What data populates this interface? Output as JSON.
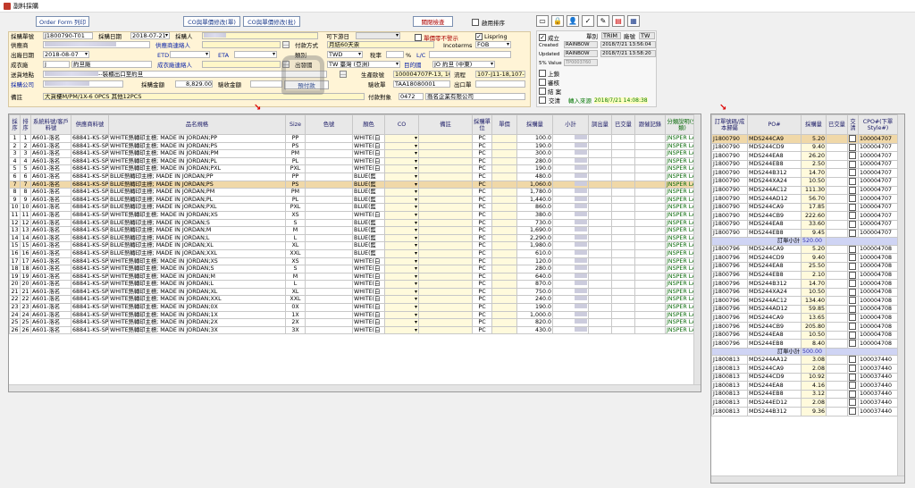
{
  "window": {
    "title": "副料採購"
  },
  "top": {
    "order_form_btn": "Order Form 列印",
    "co_change_btn1": "CO與單價修改(單)",
    "co_change_btn2": "CO與單價修改(批)",
    "close_btn": "關閉檢查",
    "startup_sort_label": "啟用排序"
  },
  "form": {
    "purchase_no_label": "採購單號",
    "purchase_no": "J1800790-T01",
    "purchase_date_label": "採購日期",
    "purchase_date": "2018-07-21",
    "buyer_label": "採購人",
    "deliverable_label": "可下游日",
    "price_no_warn_label": "單價零不警示",
    "lispring_label": "Lispring",
    "supplier_label": "供應商",
    "supplier_contact_label": "供應商連絡人",
    "pay_method_label": "付款方式",
    "pay_method": "月結60天票",
    "incoterms_label": "Incoterms",
    "incoterms": "FOB",
    "ship_date_label": "出廠日期",
    "ship_date": "2018-08-07",
    "etd_label": "ETD",
    "eta_label": "ETA",
    "category_label": "類別",
    "category": "TWD",
    "tax_label": "稅率",
    "tax_pct": "%",
    "lc_label": "L/C",
    "factory_label": "成衣廠",
    "factory_code": "J",
    "factory_name": "約旦廠",
    "factory_contact_label": "成衣廠連絡人",
    "origin_label": "出發國",
    "origin": "TW 臺灣 (亞洲)",
    "dest_label": "目的國",
    "dest": "JO 約旦 (中東)",
    "ship_addr_label": "送貨地點",
    "ship_addr": "--裝櫃出口至約旦",
    "prod_order_label": "生產歐號",
    "prod_order": "100004707P-13, 100",
    "flow_label": "流程",
    "flow": "107-J11-18,107-J11-",
    "company_label": "採購公司",
    "amount_label": "採購金額",
    "amount": "8,829.00",
    "receipt_amt_label": "驗收金額",
    "prepay_label": "預付款",
    "receipt_no_label": "驗收單",
    "receipt_no": "TAA18080001",
    "export_no_label": "出口單",
    "note_label": "備註",
    "note": "大貨樓M/PM/1X-6 0PCS 其他12PCS",
    "pay_target_label": "付款對象",
    "pay_target_code": "0472",
    "pay_target": "喬名企業有限公司"
  },
  "status": {
    "established_label": "成立",
    "single_label": "單別",
    "single": "TRIM",
    "size_label": "廠號",
    "size": "TW",
    "created_label": "Created",
    "created_by": "RAINBOW",
    "created_at": "2018/7/21 13:56:04",
    "updated_label": "Updated",
    "updated_by": "RAINBOW",
    "updated_at": "2018/7/21 13:58:20",
    "value_label": "5% Value",
    "value": "TP0003760",
    "approve_label": "上鎖",
    "review_label": "審核",
    "closed_label": "結 案",
    "delivered_label": "交清",
    "source_label": "轉入來源",
    "source_time": "2018/7/21 14:08:38"
  },
  "grid": {
    "headers": [
      "採序",
      "排序",
      "系統料號/客戶料號",
      "供應商料號",
      "品名規格",
      "Size",
      "色號",
      "顏色",
      "CO",
      "備註",
      "採購單位",
      "單價",
      "採購量",
      "小計",
      "調出量",
      "已交量",
      "跟催記錄",
      "分類說明(分類)"
    ],
    "rows": [
      [
        "1",
        "1",
        "A601-洛名",
        "68841-KS-SPC",
        "WHITE熱轉印主標; MADE IN JORDAN;PP",
        "PP",
        "",
        "WHITE(白",
        "",
        "",
        "PC",
        "",
        "100.0",
        "",
        "",
        "",
        "",
        "JNSPER LA("
      ],
      [
        "2",
        "2",
        "A601-洛名",
        "68841-KS-SPC",
        "WHITE熱轉印主標; MADE IN JORDAN;PS",
        "PS",
        "",
        "WHITE(白",
        "",
        "",
        "PC",
        "",
        "190.0",
        "",
        "",
        "",
        "",
        "JNSPER LA("
      ],
      [
        "3",
        "3",
        "A601-洛名",
        "68841-KS-SPC",
        "WHITE熱轉印主標; MADE IN JORDAN;PM",
        "PM",
        "",
        "WHITE(白",
        "",
        "",
        "PC",
        "",
        "300.0",
        "",
        "",
        "",
        "",
        "JNSPER LA("
      ],
      [
        "4",
        "4",
        "A601-洛名",
        "68841-KS-SPC",
        "WHITE熱轉印主標; MADE IN JORDAN;PL",
        "PL",
        "",
        "WHITE(白",
        "",
        "",
        "PC",
        "",
        "280.0",
        "",
        "",
        "",
        "",
        "JNSPER LA("
      ],
      [
        "5",
        "5",
        "A601-洛名",
        "68841-KS-SPC",
        "WHITE熱轉印主標; MADE IN JORDAN;PXL",
        "PXL",
        "",
        "WHITE(白",
        "",
        "",
        "PC",
        "",
        "190.0",
        "",
        "",
        "",
        "",
        "JNSPER LA("
      ],
      [
        "6",
        "6",
        "A601-洛名",
        "68841-KS-SPC",
        "BLUE熱轉印主標; MADE IN JORDAN;PP",
        "PP",
        "",
        "BLUE(藍",
        "",
        "",
        "PC",
        "",
        "480.0",
        "",
        "",
        "",
        "",
        "JNSPER LA("
      ],
      [
        "7",
        "7",
        "A601-洛名",
        "68841-KS-SPC",
        "BLUE熱轉印主標; MADE IN JORDAN;PS",
        "PS",
        "",
        "BLUE(藍",
        "",
        "",
        "PC",
        "",
        "1,060.0",
        "",
        "",
        "",
        "",
        "JNSPER LA("
      ],
      [
        "8",
        "8",
        "A601-洛名",
        "68841-KS-SPC",
        "BLUE熱轉印主標; MADE IN JORDAN;PM",
        "PM",
        "",
        "BLUE(藍",
        "",
        "",
        "PC",
        "",
        "1,780.0",
        "",
        "",
        "",
        "",
        "JNSPER LA("
      ],
      [
        "9",
        "9",
        "A601-洛名",
        "68841-KS-SPC",
        "BLUE熱轉印主標; MADE IN JORDAN;PL",
        "PL",
        "",
        "BLUE(藍",
        "",
        "",
        "PC",
        "",
        "1,440.0",
        "",
        "",
        "",
        "",
        "JNSPER LA("
      ],
      [
        "10",
        "10",
        "A601-洛名",
        "68841-KS-SPC",
        "BLUE熱轉印主標; MADE IN JORDAN;PXL",
        "PXL",
        "",
        "BLUE(藍",
        "",
        "",
        "PC",
        "",
        "860.0",
        "",
        "",
        "",
        "",
        "JNSPER LA("
      ],
      [
        "11",
        "11",
        "A601-洛名",
        "68841-KS-SPC",
        "WHITE熱轉印主標; MADE IN JORDAN;XS",
        "XS",
        "",
        "WHITE(白",
        "",
        "",
        "PC",
        "",
        "380.0",
        "",
        "",
        "",
        "",
        "JNSPER LA("
      ],
      [
        "12",
        "12",
        "A601-洛名",
        "68841-KS-SPC",
        "BLUE熱轉印主標; MADE IN JORDAN;S",
        "S",
        "",
        "BLUE(藍",
        "",
        "",
        "PC",
        "",
        "730.0",
        "",
        "",
        "",
        "",
        "JNSPER LA("
      ],
      [
        "13",
        "13",
        "A601-洛名",
        "68841-KS-SPC",
        "BLUE熱轉印主標; MADE IN JORDAN;M",
        "M",
        "",
        "BLUE(藍",
        "",
        "",
        "PC",
        "",
        "1,690.0",
        "",
        "",
        "",
        "",
        "JNSPER LA("
      ],
      [
        "14",
        "14",
        "A601-洛名",
        "68841-KS-SPC",
        "BLUE熱轉印主標; MADE IN JORDAN;L",
        "L",
        "",
        "BLUE(藍",
        "",
        "",
        "PC",
        "",
        "2,290.0",
        "",
        "",
        "",
        "",
        "JNSPER LA("
      ],
      [
        "15",
        "15",
        "A601-洛名",
        "68841-KS-SPC",
        "BLUE熱轉印主標; MADE IN JORDAN;XL",
        "XL",
        "",
        "BLUE(藍",
        "",
        "",
        "PC",
        "",
        "1,980.0",
        "",
        "",
        "",
        "",
        "JNSPER LA("
      ],
      [
        "16",
        "16",
        "A601-洛名",
        "68841-KS-SPC",
        "BLUE熱轉印主標; MADE IN JORDAN;XXL",
        "XXL",
        "",
        "BLUE(藍",
        "",
        "",
        "PC",
        "",
        "610.0",
        "",
        "",
        "",
        "",
        "JNSPER LA("
      ],
      [
        "17",
        "17",
        "A601-洛名",
        "68841-KS-SPC",
        "WHITE熱轉印主標; MADE IN JORDAN;XS",
        "XS",
        "",
        "WHITE(白",
        "",
        "",
        "PC",
        "",
        "120.0",
        "",
        "",
        "",
        "",
        "JNSPER LA("
      ],
      [
        "18",
        "18",
        "A601-洛名",
        "68841-KS-SPC",
        "WHITE熱轉印主標; MADE IN JORDAN;S",
        "S",
        "",
        "WHITE(白",
        "",
        "",
        "PC",
        "",
        "280.0",
        "",
        "",
        "",
        "",
        "JNSPER LA("
      ],
      [
        "19",
        "19",
        "A601-洛名",
        "68841-KS-SPC",
        "WHITE熱轉印主標; MADE IN JORDAN;M",
        "M",
        "",
        "WHITE(白",
        "",
        "",
        "PC",
        "",
        "640.0",
        "",
        "",
        "",
        "",
        "JNSPER LA("
      ],
      [
        "20",
        "20",
        "A601-洛名",
        "68841-KS-SPC",
        "WHITE熱轉印主標; MADE IN JORDAN;L",
        "L",
        "",
        "WHITE(白",
        "",
        "",
        "PC",
        "",
        "870.0",
        "",
        "",
        "",
        "",
        "JNSPER LA("
      ],
      [
        "21",
        "21",
        "A601-洛名",
        "68841-KS-SPC",
        "WHITE熱轉印主標; MADE IN JORDAN;XL",
        "XL",
        "",
        "WHITE(白",
        "",
        "",
        "PC",
        "",
        "750.0",
        "",
        "",
        "",
        "",
        "JNSPER LA("
      ],
      [
        "22",
        "22",
        "A601-洛名",
        "68841-KS-SPC",
        "WHITE熱轉印主標; MADE IN JORDAN;XXL",
        "XXL",
        "",
        "WHITE(白",
        "",
        "",
        "PC",
        "",
        "240.0",
        "",
        "",
        "",
        "",
        "JNSPER LA("
      ],
      [
        "23",
        "23",
        "A601-洛名",
        "68841-KS-SPC",
        "WHITE熱轉印主標; MADE IN JORDAN;0X",
        "0X",
        "",
        "WHITE(白",
        "",
        "",
        "PC",
        "",
        "190.0",
        "",
        "",
        "",
        "",
        "JNSPER LA("
      ],
      [
        "24",
        "24",
        "A601-洛名",
        "68841-KS-SPC",
        "WHITE熱轉印主標; MADE IN JORDAN;1X",
        "1X",
        "",
        "WHITE(白",
        "",
        "",
        "PC",
        "",
        "1,000.0",
        "",
        "",
        "",
        "",
        "JNSPER LA("
      ],
      [
        "25",
        "25",
        "A601-洛名",
        "68841-KS-SPC",
        "WHITE熱轉印主標; MADE IN JORDAN;2X",
        "2X",
        "",
        "WHITE(白",
        "",
        "",
        "PC",
        "",
        "820.0",
        "",
        "",
        "",
        "",
        "JNSPER LA("
      ],
      [
        "26",
        "26",
        "A601-洛名",
        "68841-KS-SPC",
        "WHITE熱轉印主標; MADE IN JORDAN;3X",
        "3X",
        "",
        "WHITE(白",
        "",
        "",
        "PC",
        "",
        "430.0",
        "",
        "",
        "",
        "",
        "JNSPER LA("
      ]
    ]
  },
  "right": {
    "headers": [
      "訂單號碼/成本歸屬",
      "PO#",
      "採購量",
      "已交量",
      "交清",
      "CPO#(下單Style#)"
    ],
    "rows": [
      {
        "t": "r",
        "c": [
          "J1800790",
          "MDS244CA9",
          "5.20",
          "",
          "",
          "100004707"
        ],
        "sel": true
      },
      {
        "t": "r",
        "c": [
          "J1800790",
          "MDS244CD9",
          "9.40",
          "",
          "",
          "100004707"
        ]
      },
      {
        "t": "r",
        "c": [
          "J1800790",
          "MDS244EA8",
          "26.20",
          "",
          "",
          "100004707"
        ]
      },
      {
        "t": "r",
        "c": [
          "J1800790",
          "MDS244EB8",
          "2.50",
          "",
          "",
          "100004707"
        ]
      },
      {
        "t": "r",
        "c": [
          "J1800790",
          "MDS244B312",
          "14.70",
          "",
          "",
          "100004707"
        ]
      },
      {
        "t": "r",
        "c": [
          "J1800790",
          "MDS244XA24",
          "10.50",
          "",
          "",
          "100004707"
        ]
      },
      {
        "t": "r",
        "c": [
          "J1800790",
          "MDS244AC12",
          "111.30",
          "",
          "",
          "100004707"
        ]
      },
      {
        "t": "r",
        "c": [
          "J1800790",
          "MDS244AD12",
          "56.70",
          "",
          "",
          "100004707"
        ]
      },
      {
        "t": "r",
        "c": [
          "J1800790",
          "MDS244CA9",
          "17.85",
          "",
          "",
          "100004707"
        ]
      },
      {
        "t": "r",
        "c": [
          "J1800790",
          "MDS244CB9",
          "222.60",
          "",
          "",
          "100004707"
        ]
      },
      {
        "t": "r",
        "c": [
          "J1800790",
          "MDS244EA8",
          "33.60",
          "",
          "",
          "100004707"
        ]
      },
      {
        "t": "r",
        "c": [
          "J1800790",
          "MDS244EB8",
          "9.45",
          "",
          "",
          "100004707"
        ]
      },
      {
        "t": "s",
        "label": "訂單小計",
        "value": "520.00"
      },
      {
        "t": "r",
        "c": [
          "J1800796",
          "MDS244CA9",
          "5.20",
          "",
          "",
          "100004708"
        ]
      },
      {
        "t": "r",
        "c": [
          "J1800796",
          "MDS244CD9",
          "9.40",
          "",
          "",
          "100004708"
        ]
      },
      {
        "t": "r",
        "c": [
          "J1800796",
          "MDS244EA8",
          "25.50",
          "",
          "",
          "100004708"
        ]
      },
      {
        "t": "r",
        "c": [
          "J1800796",
          "MDS244EB8",
          "2.10",
          "",
          "",
          "100004708"
        ]
      },
      {
        "t": "r",
        "c": [
          "J1800796",
          "MDS244B312",
          "14.70",
          "",
          "",
          "100004708"
        ]
      },
      {
        "t": "r",
        "c": [
          "J1800796",
          "MDS244XA24",
          "10.50",
          "",
          "",
          "100004708"
        ]
      },
      {
        "t": "r",
        "c": [
          "J1800796",
          "MDS244AC12",
          "134.40",
          "",
          "",
          "100004708"
        ]
      },
      {
        "t": "r",
        "c": [
          "J1800796",
          "MDS244AD12",
          "59.85",
          "",
          "",
          "100004708"
        ]
      },
      {
        "t": "r",
        "c": [
          "J1800796",
          "MDS244CA9",
          "13.65",
          "",
          "",
          "100004708"
        ]
      },
      {
        "t": "r",
        "c": [
          "J1800796",
          "MDS244CB9",
          "205.80",
          "",
          "",
          "100004708"
        ]
      },
      {
        "t": "r",
        "c": [
          "J1800796",
          "MDS244EA8",
          "10.50",
          "",
          "",
          "100004708"
        ]
      },
      {
        "t": "r",
        "c": [
          "J1800796",
          "MDS244EB8",
          "8.40",
          "",
          "",
          "100004708"
        ]
      },
      {
        "t": "s",
        "label": "訂單小計",
        "value": "500.00"
      },
      {
        "t": "r",
        "c": [
          "J1800813",
          "MDS244AA12",
          "3.08",
          "",
          "",
          "100037440"
        ]
      },
      {
        "t": "r",
        "c": [
          "J1800813",
          "MDS244CA9",
          "2.08",
          "",
          "",
          "100037440"
        ]
      },
      {
        "t": "r",
        "c": [
          "J1800813",
          "MDS244CD9",
          "10.92",
          "",
          "",
          "100037440"
        ]
      },
      {
        "t": "r",
        "c": [
          "J1800813",
          "MDS244EA8",
          "4.16",
          "",
          "",
          "100037440"
        ]
      },
      {
        "t": "r",
        "c": [
          "J1800813",
          "MDS244EB8",
          "3.12",
          "",
          "",
          "100037440"
        ]
      },
      {
        "t": "r",
        "c": [
          "J1800813",
          "MDS244ED12",
          "2.08",
          "",
          "",
          "100037440"
        ]
      },
      {
        "t": "r",
        "c": [
          "J1800813",
          "MDS244B312",
          "9.36",
          "",
          "",
          "100037440"
        ]
      }
    ]
  }
}
